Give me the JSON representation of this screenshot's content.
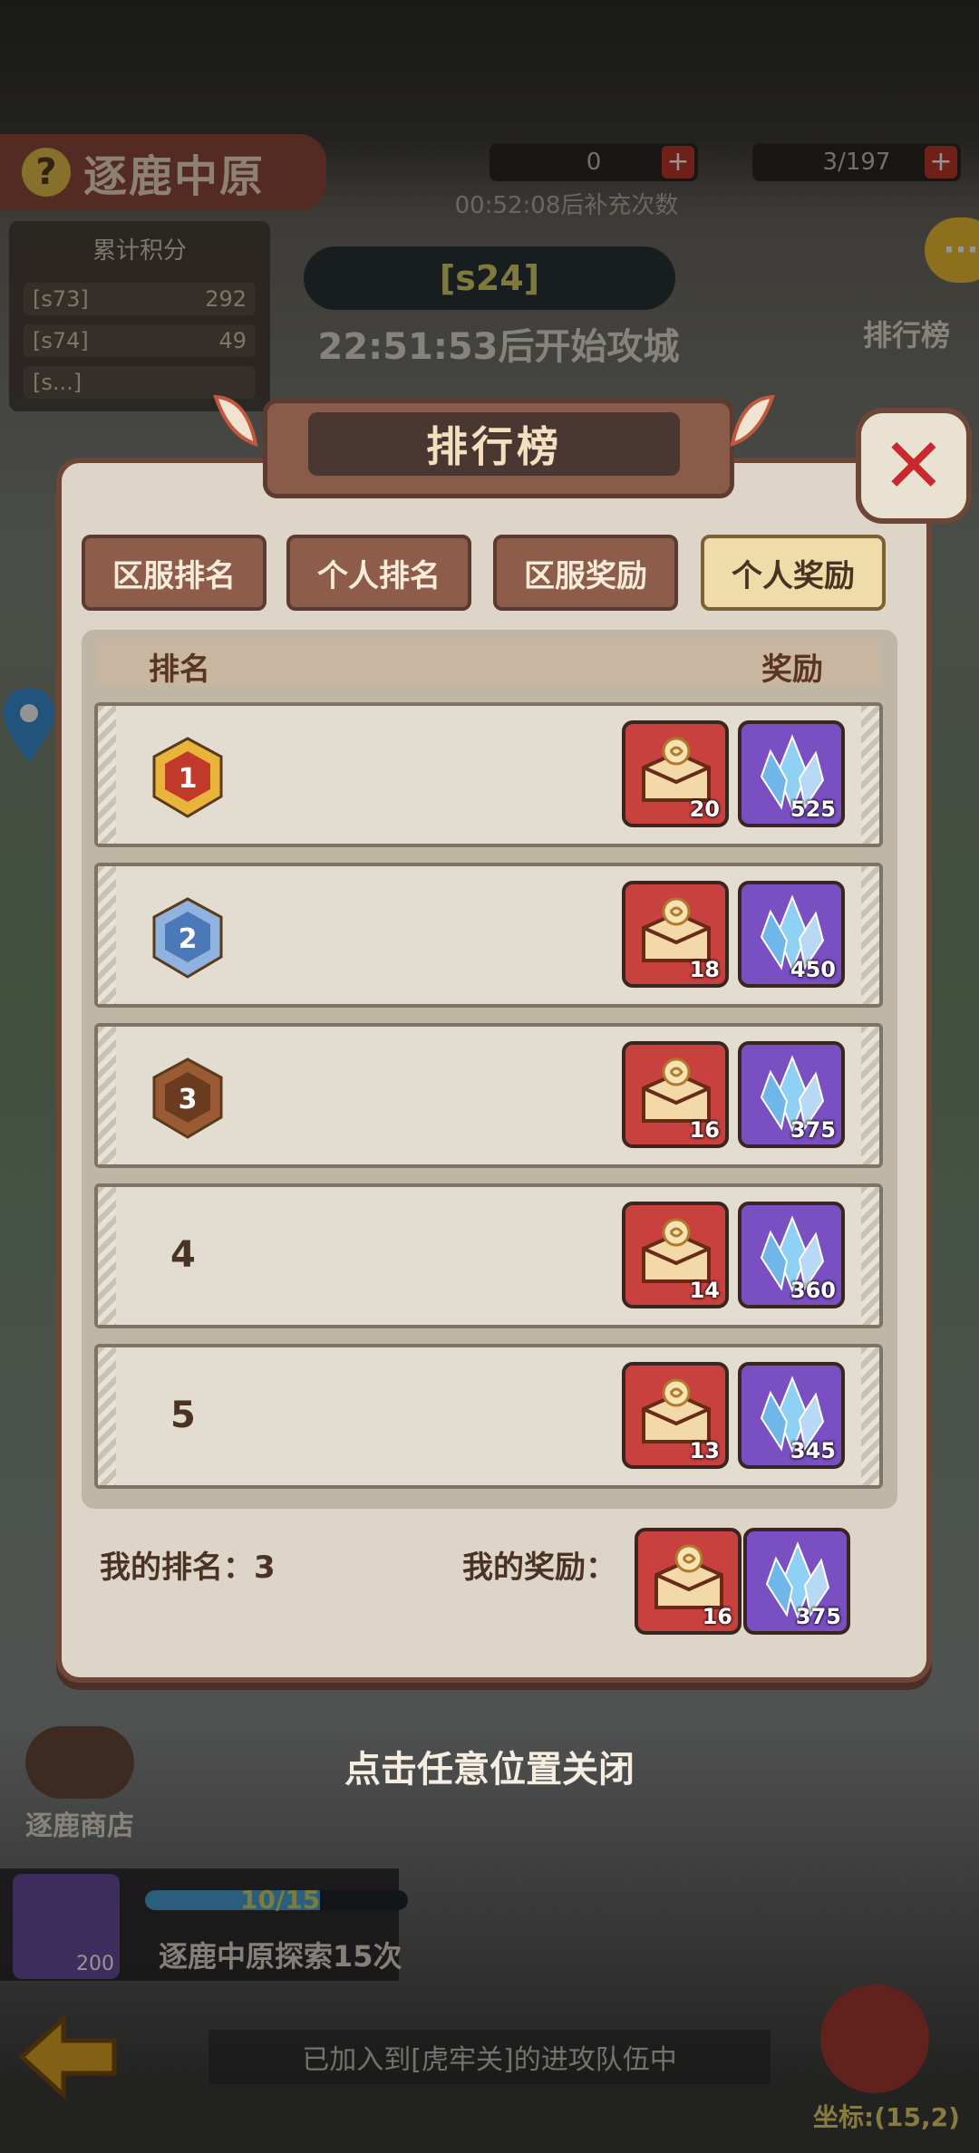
{
  "background": {
    "mode_title": "逐鹿中原",
    "resource_1": "0",
    "resource_2": "3/197",
    "refill_timer": "00:52:08后补充次数",
    "cumulative_score_label": "累计积分",
    "score_rows": [
      {
        "server": "[s73]",
        "points": "292"
      },
      {
        "server": "[s74]",
        "points": "49"
      },
      {
        "server": "[s...]",
        "points": ""
      }
    ],
    "server_banner": "[s24]",
    "siege_timer": "22:51:53后开始攻城",
    "side_ranking": "排行榜",
    "shop_label": "逐鹿商店",
    "quest_progress": "10/15",
    "quest_progress_fraction": 0.6667,
    "quest_text": "逐鹿中原探索15次",
    "quest_icon_count": "200",
    "team_status": "已加入到[虎牢关]的进攻队伍中",
    "coord_label": "坐标:(15,2)",
    "chat_icon": "chat-bubble-icon"
  },
  "modal": {
    "title": "排行榜",
    "tabs": [
      {
        "label": "区服排名",
        "active": false
      },
      {
        "label": "个人排名",
        "active": false
      },
      {
        "label": "区服奖励",
        "active": false
      },
      {
        "label": "个人奖励",
        "active": true
      }
    ],
    "header_rank": "排名",
    "header_reward": "奖励",
    "rows": [
      {
        "rank": "1",
        "medal": "gold",
        "chest": "20",
        "crystal": "525"
      },
      {
        "rank": "2",
        "medal": "silver",
        "chest": "18",
        "crystal": "450"
      },
      {
        "rank": "3",
        "medal": "bronze",
        "chest": "16",
        "crystal": "375"
      },
      {
        "rank": "4",
        "medal": "",
        "chest": "14",
        "crystal": "360"
      },
      {
        "rank": "5",
        "medal": "",
        "chest": "13",
        "crystal": "345"
      }
    ],
    "my_rank_label": "我的排名：3",
    "my_reward_label": "我的奖励：",
    "my_reward": {
      "chest": "16",
      "crystal": "375"
    }
  },
  "hint": "点击任意位置关闭",
  "colors": {
    "chest": "#c9413f",
    "crystal": "#7a4fc2",
    "gold": "#e8b53a",
    "silver": "#8fb3de",
    "bronze": "#9a5a33"
  }
}
